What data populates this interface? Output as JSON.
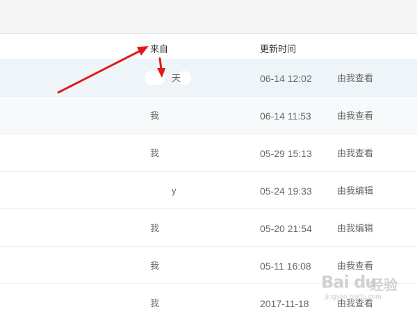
{
  "header": {
    "from_label": "来自",
    "time_label": "更新时间"
  },
  "rows": [
    {
      "from": "天",
      "time": "06-14 12:02",
      "action": "由我查看"
    },
    {
      "from": "我",
      "time": "06-14 11:53",
      "action": "由我查看"
    },
    {
      "from": "我",
      "time": "05-29 15:13",
      "action": "由我查看"
    },
    {
      "from": "y",
      "time": "05-24 19:33",
      "action": "由我编辑"
    },
    {
      "from": "我",
      "time": "05-20 21:54",
      "action": "由我编辑"
    },
    {
      "from": "我",
      "time": "05-11 16:08",
      "action": "由我查看"
    },
    {
      "from": "我",
      "time": "2017-11-18",
      "action": "由我查看"
    }
  ],
  "watermark": {
    "logo": "Bai du",
    "cn": "经验",
    "sub": "jingyan.baidu.com"
  },
  "colors": {
    "arrow": "#e0191a",
    "row_highlight": "#eef4f7"
  }
}
